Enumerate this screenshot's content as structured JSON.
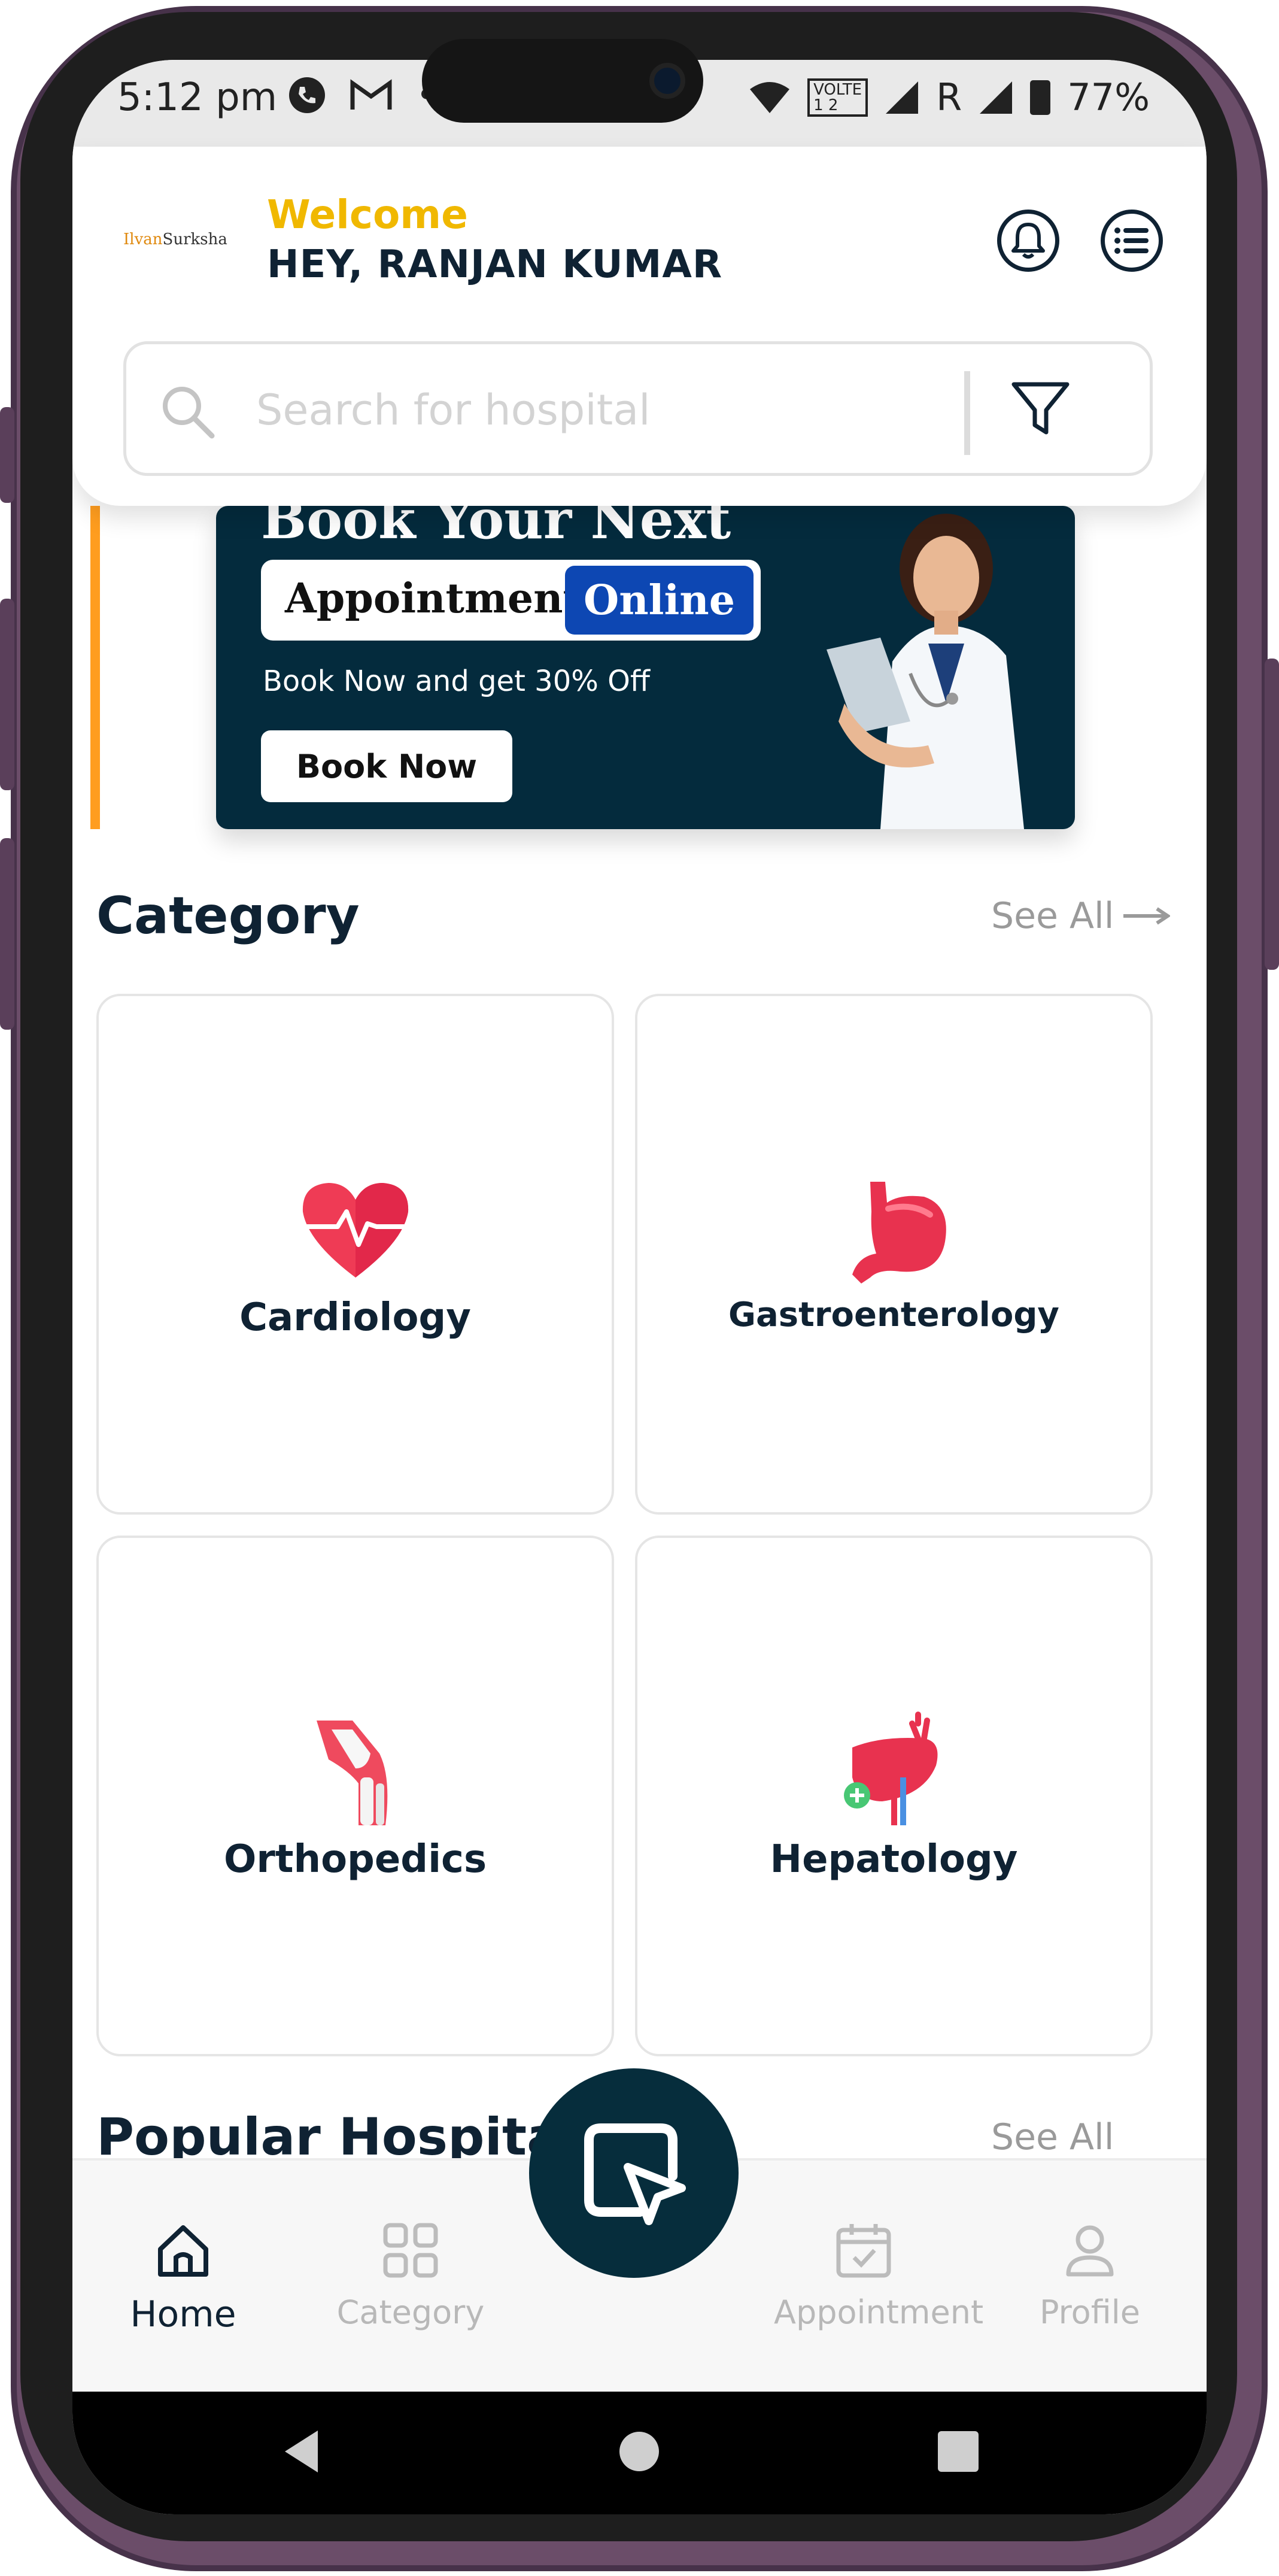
{
  "status_bar": {
    "time": "5:12 pm",
    "network_badge_top": "VOLTE",
    "network_badge_bottom": "1 2",
    "roaming": "R",
    "battery": "77%"
  },
  "header": {
    "logo_text_1": "Ilvan",
    "logo_text_2": "Surksha",
    "welcome": "Welcome",
    "greeting": "HEY, RANJAN KUMAR",
    "search_placeholder": "Search for hospital"
  },
  "banner": {
    "headline": "Book Your Next",
    "appointment_word": "Appointment",
    "online_word": "Online",
    "offer_text": "Book Now and get 30% Off",
    "button_label": "Book Now"
  },
  "category": {
    "title": "Category",
    "see_all": "See All",
    "items": [
      {
        "label": "Cardiology",
        "icon": "heart-icon"
      },
      {
        "label": "Gastroenterology",
        "icon": "stomach-icon"
      },
      {
        "label": "Orthopedics",
        "icon": "knee-joint-icon"
      },
      {
        "label": "Hepatology",
        "icon": "liver-icon"
      }
    ]
  },
  "popular": {
    "title": "Popular Hospitals",
    "see_all": "See All"
  },
  "bottom_nav": {
    "items": [
      {
        "label": "Home",
        "icon": "home-icon",
        "active": true
      },
      {
        "label": "Category",
        "icon": "grid-icon",
        "active": false
      },
      {
        "label": "Appointment",
        "icon": "calendar-icon",
        "active": false
      },
      {
        "label": "Profile",
        "icon": "user-icon",
        "active": false
      }
    ]
  },
  "colors": {
    "accent_yellow": "#f0b800",
    "dark_navy": "#0f2233",
    "banner_bg": "#042b3d",
    "online_blue": "#0d47b3",
    "heart_red": "#ef3b55"
  }
}
